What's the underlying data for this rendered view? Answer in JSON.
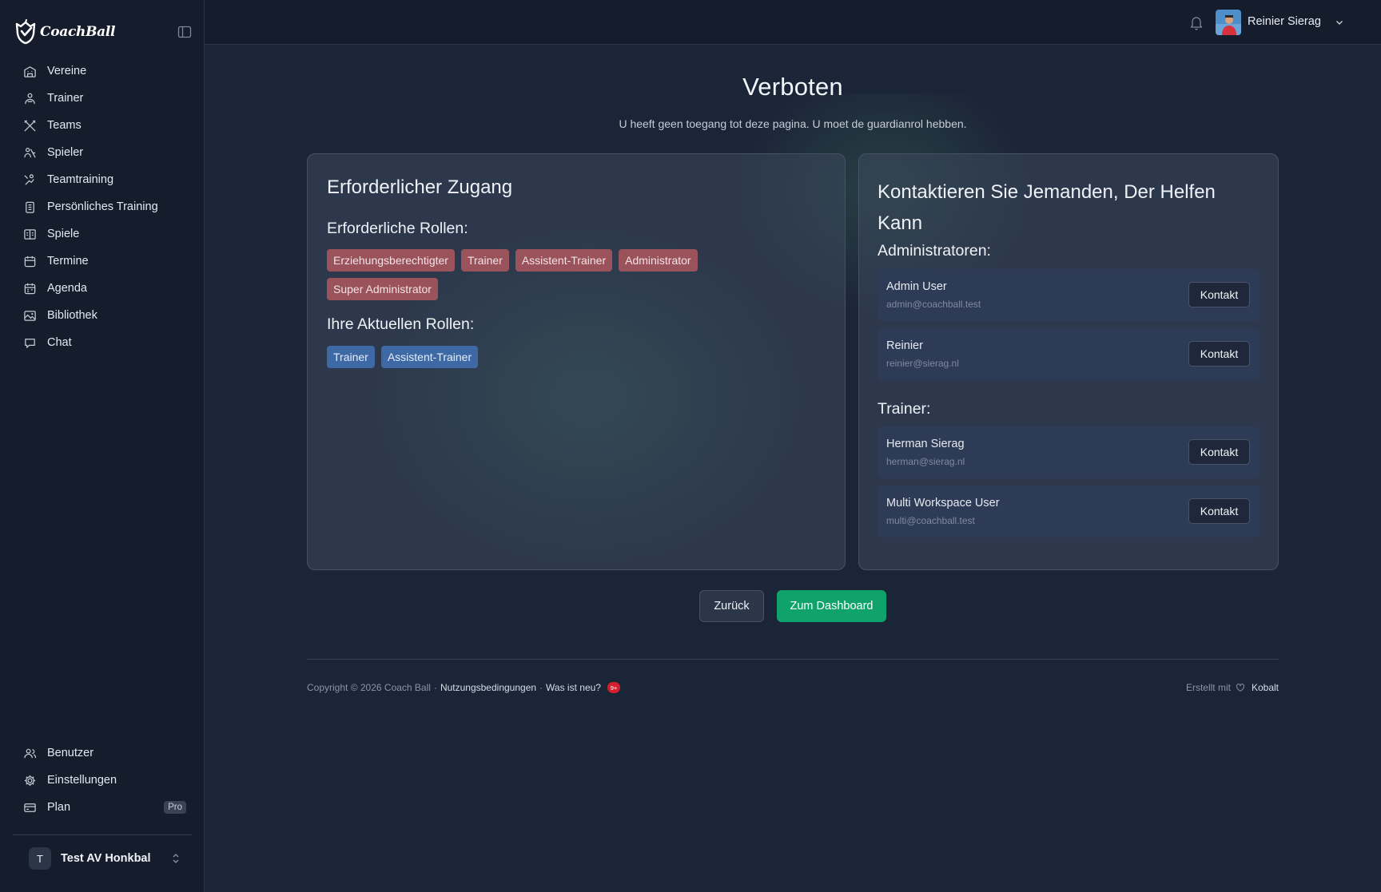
{
  "app": {
    "logo_text": "CoachBall"
  },
  "sidebar": {
    "items": [
      {
        "label": "Vereine",
        "icon": "building-icon"
      },
      {
        "label": "Trainer",
        "icon": "trainer-icon"
      },
      {
        "label": "Teams",
        "icon": "crossed-sticks-icon"
      },
      {
        "label": "Spieler",
        "icon": "players-icon"
      },
      {
        "label": "Teamtraining",
        "icon": "training-icon"
      },
      {
        "label": "Persönliches Training",
        "icon": "clipboard-icon"
      },
      {
        "label": "Spiele",
        "icon": "scoreboard-icon"
      },
      {
        "label": "Termine",
        "icon": "calendar-icon"
      },
      {
        "label": "Agenda",
        "icon": "agenda-icon"
      },
      {
        "label": "Bibliothek",
        "icon": "image-icon"
      },
      {
        "label": "Chat",
        "icon": "chat-icon"
      }
    ],
    "bottom_items": [
      {
        "label": "Benutzer",
        "icon": "users-icon"
      },
      {
        "label": "Einstellungen",
        "icon": "gear-icon"
      },
      {
        "label": "Plan",
        "icon": "credit-card-icon",
        "badge": "Pro"
      }
    ],
    "workspace": {
      "initial": "T",
      "name": "Test AV Honkbal"
    }
  },
  "topbar": {
    "user_name": "Reinier Sierag"
  },
  "main": {
    "title": "Verboten",
    "subtitle": "U heeft geen toegang tot deze pagina. U moet de guardianrol hebben.",
    "access_card": {
      "title": "Erforderlicher Zugang",
      "required_title": "Erforderliche Rollen:",
      "required_roles": [
        "Erziehungsberechtigter",
        "Trainer",
        "Assistent-Trainer",
        "Administrator",
        "Super Administrator"
      ],
      "current_title": "Ihre Aktuellen Rollen:",
      "current_roles": [
        "Trainer",
        "Assistent-Trainer"
      ]
    },
    "contact_card": {
      "title": "Kontaktieren Sie Jemanden, Der Helfen Kann",
      "admins_title": "Administratoren:",
      "admins": [
        {
          "name": "Admin User",
          "email": "admin@coachball.test",
          "button": "Kontakt"
        },
        {
          "name": "Reinier",
          "email": "reinier@sierag.nl",
          "button": "Kontakt"
        }
      ],
      "trainers_title": "Trainer:",
      "trainers": [
        {
          "name": "Herman Sierag",
          "email": "herman@sierag.nl",
          "button": "Kontakt"
        },
        {
          "name": "Multi Workspace User",
          "email": "multi@coachball.test",
          "button": "Kontakt"
        }
      ]
    },
    "buttons": {
      "back": "Zurück",
      "dashboard": "Zum Dashboard"
    }
  },
  "footer": {
    "copyright": "Copyright © 2026 Coach Ball",
    "sep1": "·",
    "terms": "Nutzungsbedingungen",
    "sep2": "·",
    "whats_new": "Was ist neu?",
    "new_badge": "9+",
    "made_with": "Erstellt mit",
    "made_by": "Kobalt"
  },
  "colors": {
    "accent_green": "#0fa36b",
    "role_required": "#9a525b",
    "role_current": "#3e69a5",
    "sidebar_bg": "#151d2d",
    "main_bg": "#1b2538"
  }
}
